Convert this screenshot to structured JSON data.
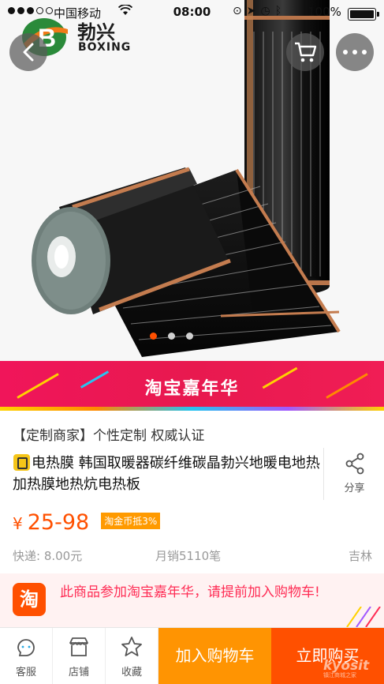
{
  "status_bar": {
    "carrier": "中国移动",
    "time": "08:00",
    "battery": "100%"
  },
  "logo": {
    "brand_cn": "勃兴",
    "brand_en": "BOXING"
  },
  "gallery": {
    "dot_count": 3,
    "active_index": 0
  },
  "banner": {
    "title": "淘宝嘉年华"
  },
  "product": {
    "promo_tag": "【定制商家】个性定制 权威认证",
    "title": "电热膜 韩国取暖器碳纤维碳晶勃兴地暖电地热加热膜地热炕电热板",
    "currency": "¥",
    "price": "25-98",
    "coin_badge": "淘金币抵3%",
    "shipping": "快递: 8.00元",
    "monthly_sales": "月销5110笔",
    "location": "吉林",
    "share_label": "分享"
  },
  "notice": {
    "icon_text": "淘",
    "text": "此商品参加淘宝嘉年华，请提前加入购物车!"
  },
  "bottom_bar": {
    "service": "客服",
    "shop": "店铺",
    "favorite": "收藏",
    "add_to_cart": "加入购物车",
    "buy_now": "立即购买"
  },
  "watermark": {
    "text": "kyosit",
    "subtext": "镇江商城之家"
  },
  "colors": {
    "accent": "#ff5000",
    "cart_orange": "#ff9402",
    "banner_red": "#e8194f",
    "notice_text": "#ff2d55"
  }
}
